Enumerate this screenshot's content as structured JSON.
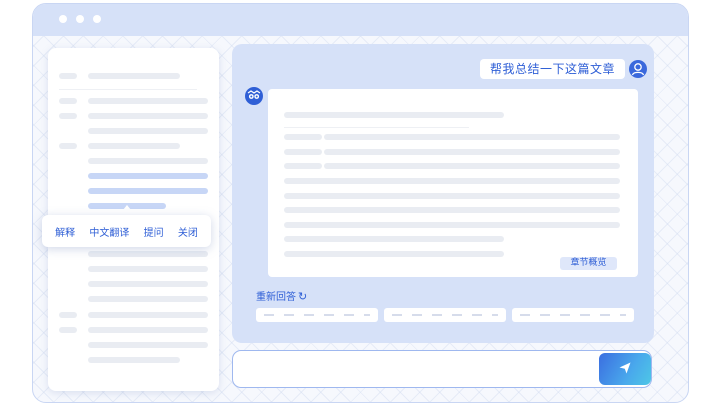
{
  "window": {
    "dots": 3
  },
  "context_menu": {
    "items": [
      {
        "label": "解释"
      },
      {
        "label": "中文翻译"
      },
      {
        "label": "提问"
      },
      {
        "label": "关闭"
      }
    ]
  },
  "chat": {
    "user_message": "帮我总结一下这篇文章",
    "chapter_badge": "章节概览",
    "regenerate_label": "重新回答",
    "suggestion_count": 3
  },
  "input": {
    "placeholder": "",
    "value": ""
  },
  "icons": {
    "user_avatar": "user-avatar-icon",
    "bot_avatar": "owl-bot-icon",
    "regenerate": "refresh-icon",
    "send": "paper-plane-icon"
  },
  "colors": {
    "accent": "#2f5fd6",
    "panel": "#d6e1f8",
    "highlight": "#c7d6f6"
  }
}
